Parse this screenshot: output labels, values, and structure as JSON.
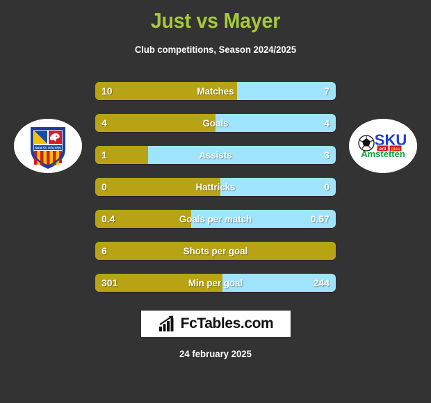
{
  "header": {
    "title": "Just vs Mayer",
    "subtitle": "Club competitions, Season 2024/2025"
  },
  "colors": {
    "background": "#333333",
    "title": "#a6c939",
    "home_bar": "#b8a314",
    "away_bar": "#9ee4fa",
    "text": "#ffffff"
  },
  "badges": {
    "home": {
      "name": "SKN St. Pölten",
      "crest_text": "SKN ST. PÖLTEN"
    },
    "away": {
      "name": "SKU Amstetten",
      "crest_text_main": "SKU",
      "crest_text_sub": "Amstetten",
      "crest_badge_left": "ertl",
      "crest_badge_right": "glas"
    }
  },
  "chart_data": {
    "type": "bar",
    "title": "Just vs Mayer",
    "subtitle": "Club competitions, Season 2024/2025",
    "orientation": "horizontal-diverging",
    "series": [
      {
        "name": "Just",
        "color": "#b8a314"
      },
      {
        "name": "Mayer",
        "color": "#9ee4fa"
      }
    ],
    "categories": [
      "Matches",
      "Goals",
      "Assists",
      "Hattricks",
      "Goals per match",
      "Shots per goal",
      "Min per goal"
    ],
    "rows": [
      {
        "label": "Matches",
        "home": "10",
        "away": "7",
        "home_pct": 59
      },
      {
        "label": "Goals",
        "home": "4",
        "away": "4",
        "home_pct": 50
      },
      {
        "label": "Assists",
        "home": "1",
        "away": "3",
        "home_pct": 22
      },
      {
        "label": "Hattricks",
        "home": "0",
        "away": "0",
        "home_pct": 52
      },
      {
        "label": "Goals per match",
        "home": "0.4",
        "away": "0.57",
        "home_pct": 40
      },
      {
        "label": "Shots per goal",
        "home": "6",
        "away": "",
        "home_pct": 100
      },
      {
        "label": "Min per goal",
        "home": "301",
        "away": "244",
        "home_pct": 53
      }
    ]
  },
  "footer": {
    "logo_text": "FcTables.com",
    "date": "24 february 2025"
  }
}
